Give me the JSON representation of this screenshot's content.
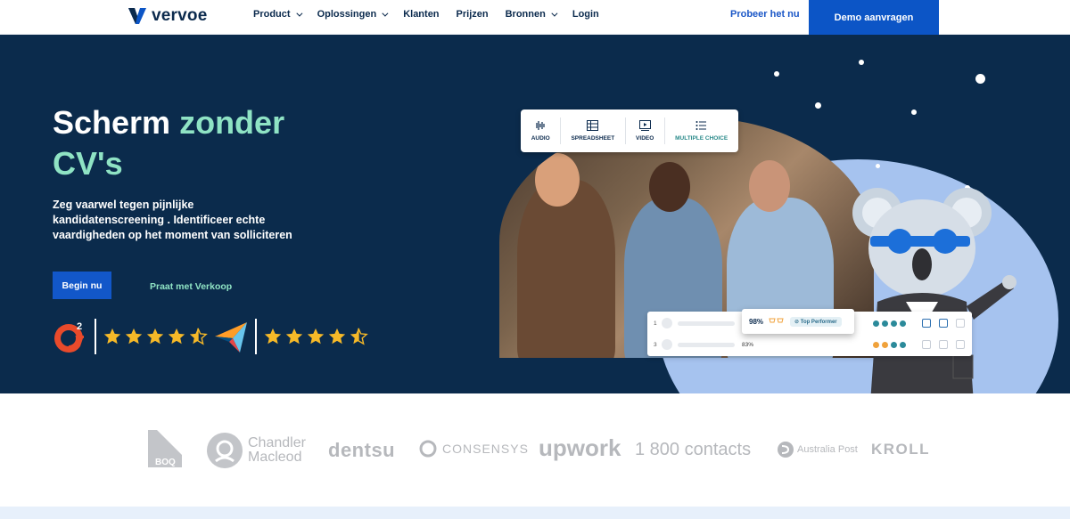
{
  "nav": {
    "logo_text": "vervoe",
    "items": [
      {
        "label": "Product",
        "has_dropdown": true
      },
      {
        "label": "Oplossingen",
        "has_dropdown": true
      },
      {
        "label": "Klanten",
        "has_dropdown": false
      },
      {
        "label": "Prijzen",
        "has_dropdown": false
      },
      {
        "label": "Bronnen",
        "has_dropdown": true
      },
      {
        "label": "Login",
        "has_dropdown": false
      }
    ],
    "trial_link": "Probeer het nu",
    "demo_button": "Demo aanvragen"
  },
  "hero": {
    "title_part1": "Scherm ",
    "title_accent_1": "zonder",
    "title_accent_2": "CV's",
    "lead": "Zeg vaarwel tegen pijnlijke kandidatenscreening . Identificeer echte vaardigheden op het moment van solliciteren",
    "primary_button": "Begin nu",
    "secondary_link": "Praat met Verkoop",
    "g2_rating": 4.5,
    "capterra_rating": 4.5
  },
  "question_types": [
    {
      "label": "AUDIO",
      "icon": "audio-wave-icon"
    },
    {
      "label": "SPREADSHEET",
      "icon": "spreadsheet-icon"
    },
    {
      "label": "VIDEO",
      "icon": "video-icon"
    },
    {
      "label": "MULTIPLE CHOICE",
      "icon": "list-icon"
    }
  ],
  "candidate_card": {
    "rows": [
      {
        "rank": "1"
      },
      {
        "rank": "3",
        "score": "83%"
      }
    ],
    "top_score": "98%",
    "badge": "Top Performer"
  },
  "colors": {
    "navy": "#0b2b4c",
    "mint": "#8fe3c4",
    "blue": "#0c55c6",
    "star": "#f6b928"
  },
  "client_logos": [
    "BOQ",
    "Chandler Macleod",
    "dentsu",
    "CONSENSYS",
    "upwork",
    "1 800 contacts",
    "Australia Post",
    "KROLL"
  ]
}
